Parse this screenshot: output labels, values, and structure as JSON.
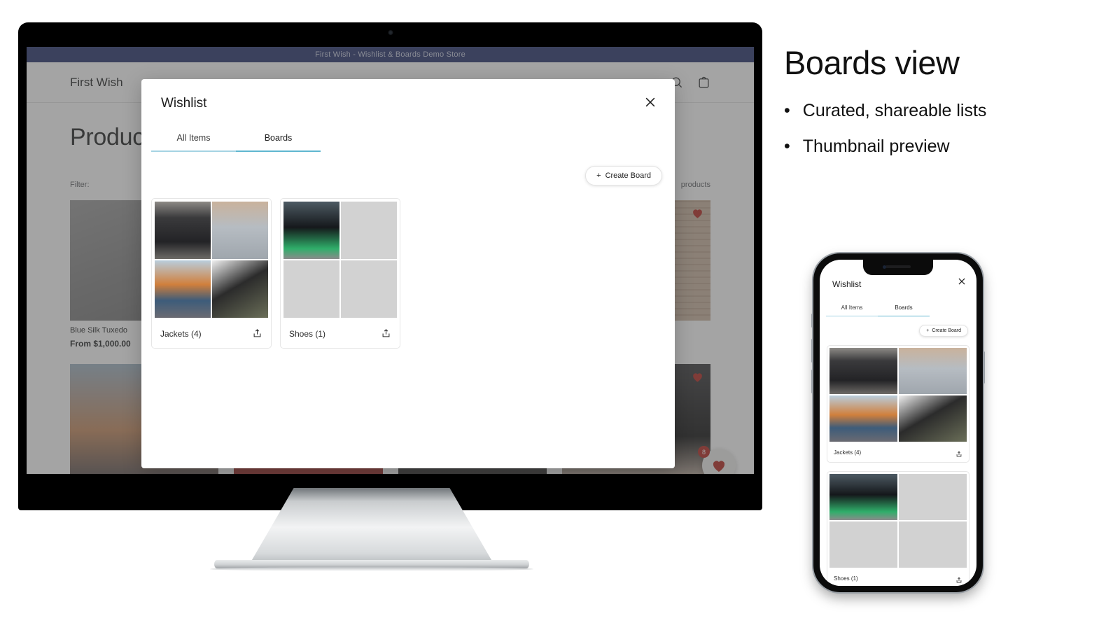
{
  "storefront": {
    "announcement": "First Wish - Wishlist & Boards Demo Store",
    "brand": "First Wish",
    "page_title": "Products",
    "filter_label": "Filter:",
    "product_count": "products",
    "search_icon": "search-icon",
    "cart_icon": "shopping-bag-icon",
    "fab_badge": "8",
    "products": [
      {
        "title": "Blue Silk Tuxedo",
        "price": "From $1,000.00",
        "favorited": false
      },
      {
        "title": "",
        "price": "",
        "favorited": false
      },
      {
        "title": "",
        "price": "",
        "favorited": false
      },
      {
        "title": "",
        "price": "",
        "favorited": true
      }
    ]
  },
  "modal": {
    "title": "Wishlist",
    "close_icon": "close-icon",
    "tabs": [
      {
        "label": "All Items",
        "active": false
      },
      {
        "label": "Boards",
        "active": true
      }
    ],
    "create_board_label": "Create Board",
    "create_board_icon": "plus-icon",
    "boards": [
      {
        "name": "Jackets (4)",
        "share_icon": "share-icon",
        "thumbs": [
          "leather-jacket",
          "varsity-jacket",
          "denim-jacket",
          "graffiti-coat"
        ]
      },
      {
        "name": "Shoes (1)",
        "share_icon": "share-icon",
        "thumbs": [
          "led-sneaker",
          "empty",
          "empty",
          "empty"
        ]
      }
    ]
  },
  "callout": {
    "heading": "Boards view",
    "bullets": [
      "Curated, shareable lists",
      "Thumbnail preview"
    ],
    "bullet_glyph": "•"
  },
  "phone": {
    "title": "Wishlist",
    "close_icon": "close-icon",
    "tabs": [
      {
        "label": "All Items",
        "active": false
      },
      {
        "label": "Boards",
        "active": true
      }
    ],
    "create_board_label": "Create Board",
    "boards": [
      {
        "name": "Jackets (4)",
        "share_icon": "share-icon",
        "thumbs": [
          "leather-jacket",
          "varsity-jacket",
          "denim-jacket",
          "graffiti-coat"
        ]
      },
      {
        "name": "Shoes (1)",
        "share_icon": "share-icon",
        "thumbs": [
          "led-sneaker",
          "empty",
          "empty",
          "empty"
        ]
      }
    ]
  },
  "colors": {
    "announcement_bg": "#25316b",
    "tab_underline_active": "#5fb6d0",
    "tab_underline_inactive": "#a5d3e3",
    "heart_red": "#b3261e",
    "modal_bg": "#ffffff",
    "placeholder_grey": "#d2d2d2"
  }
}
